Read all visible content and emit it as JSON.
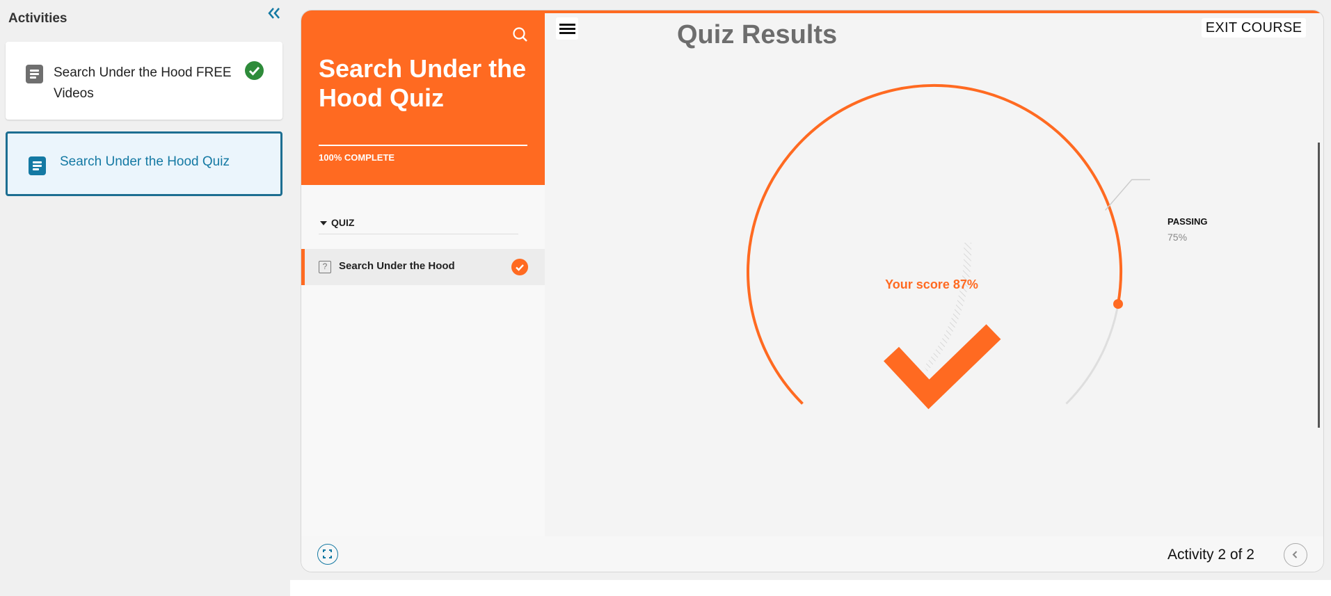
{
  "sidebar": {
    "title": "Activities",
    "items": [
      {
        "label": "Search Under the Hood FREE Videos",
        "completed": true,
        "icon": "document-icon"
      },
      {
        "label": "Search Under the Hood Quiz",
        "active": true,
        "icon": "document-icon"
      }
    ]
  },
  "course": {
    "title": "Search Under the Hood Quiz",
    "progress_text": "100% COMPLETE",
    "menu": {
      "section_label": "QUIZ",
      "lesson_label": "Search Under the Hood"
    }
  },
  "main": {
    "title": "Quiz Results",
    "exit_label": "EXIT COURSE",
    "score_text": "Your score 87%",
    "score": 0.87,
    "passing_label": "PASSING",
    "passing_value": "75%",
    "passing": 0.75
  },
  "footer": {
    "activity_count": "Activity 2 of 2"
  },
  "colors": {
    "accent": "#ff6a21",
    "link": "#1479a3",
    "success": "#2e8b3a"
  }
}
